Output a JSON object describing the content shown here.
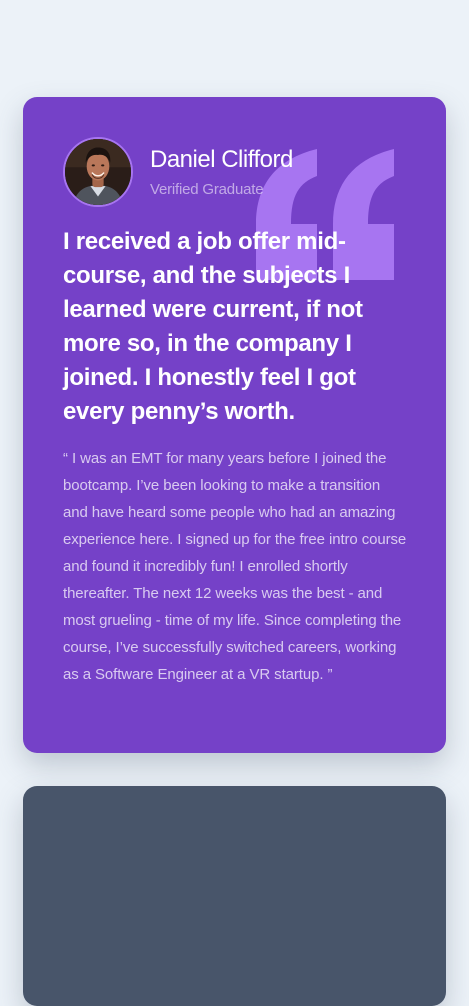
{
  "testimonial": {
    "name": "Daniel Clifford",
    "role": "Verified Graduate",
    "headline": "I received a job offer mid-course, and the subjects I learned were current, if not more so, in the company I joined. I honestly feel I got every penny’s worth.",
    "body": "“ I was an EMT for many years before I joined the bootcamp. I’ve been looking to make a transition and have heard some people who had an amazing experience here. I signed up for the free intro course and found it incredibly fun! I enrolled shortly thereafter. The next 12 weeks was the best - and most grueling - time of my life. Since completing the course, I’ve successfully switched careers, working as a Software Engineer at a VR startup. ”",
    "avatar_icon": "avatar-photo",
    "quote_icon": "quotation-mark-icon"
  },
  "colors": {
    "page_background": "#ecf2f8",
    "card_purple": "#7541c8",
    "quote_mark": "#a775f1",
    "card_gray": "#48556a"
  }
}
